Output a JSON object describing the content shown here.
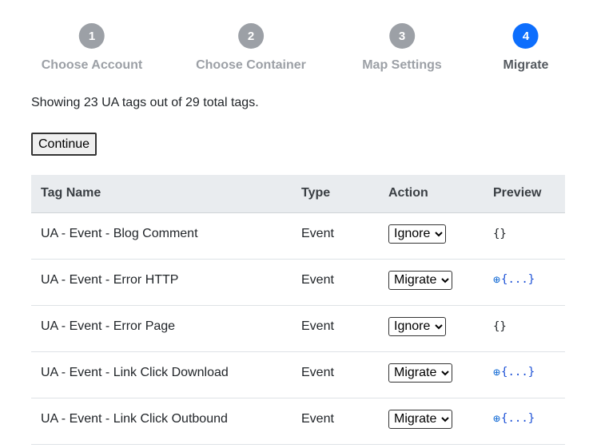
{
  "stepper": {
    "steps": [
      {
        "number": "1",
        "label": "Choose Account"
      },
      {
        "number": "2",
        "label": "Choose Container"
      },
      {
        "number": "3",
        "label": "Map Settings"
      },
      {
        "number": "4",
        "label": "Migrate"
      }
    ],
    "active_step": 4
  },
  "summary": "Showing 23 UA tags out of 29 total tags.",
  "continue_label": "Continue",
  "table": {
    "headers": [
      "Tag Name",
      "Type",
      "Action",
      "Preview"
    ],
    "rows": [
      {
        "name": "UA - Event - Blog Comment",
        "type": "Event",
        "action": "Ignore",
        "preview": "{}"
      },
      {
        "name": "UA - Event - Error HTTP",
        "type": "Event",
        "action": "Migrate",
        "preview": "{...}"
      },
      {
        "name": "UA - Event - Error Page",
        "type": "Event",
        "action": "Ignore",
        "preview": "{}"
      },
      {
        "name": "UA - Event - Link Click Download",
        "type": "Event",
        "action": "Migrate",
        "preview": "{...}"
      },
      {
        "name": "UA - Event - Link Click Outbound",
        "type": "Event",
        "action": "Migrate",
        "preview": "{...}"
      }
    ],
    "action_options": [
      "Migrate",
      "Ignore"
    ]
  },
  "colors": {
    "active_step": "#0d6efd",
    "inactive_step": "#9ca0a6",
    "header_bg": "#e9ecef",
    "link": "#1a4fd6"
  },
  "icons": {
    "expand": "plus-circle-icon"
  }
}
